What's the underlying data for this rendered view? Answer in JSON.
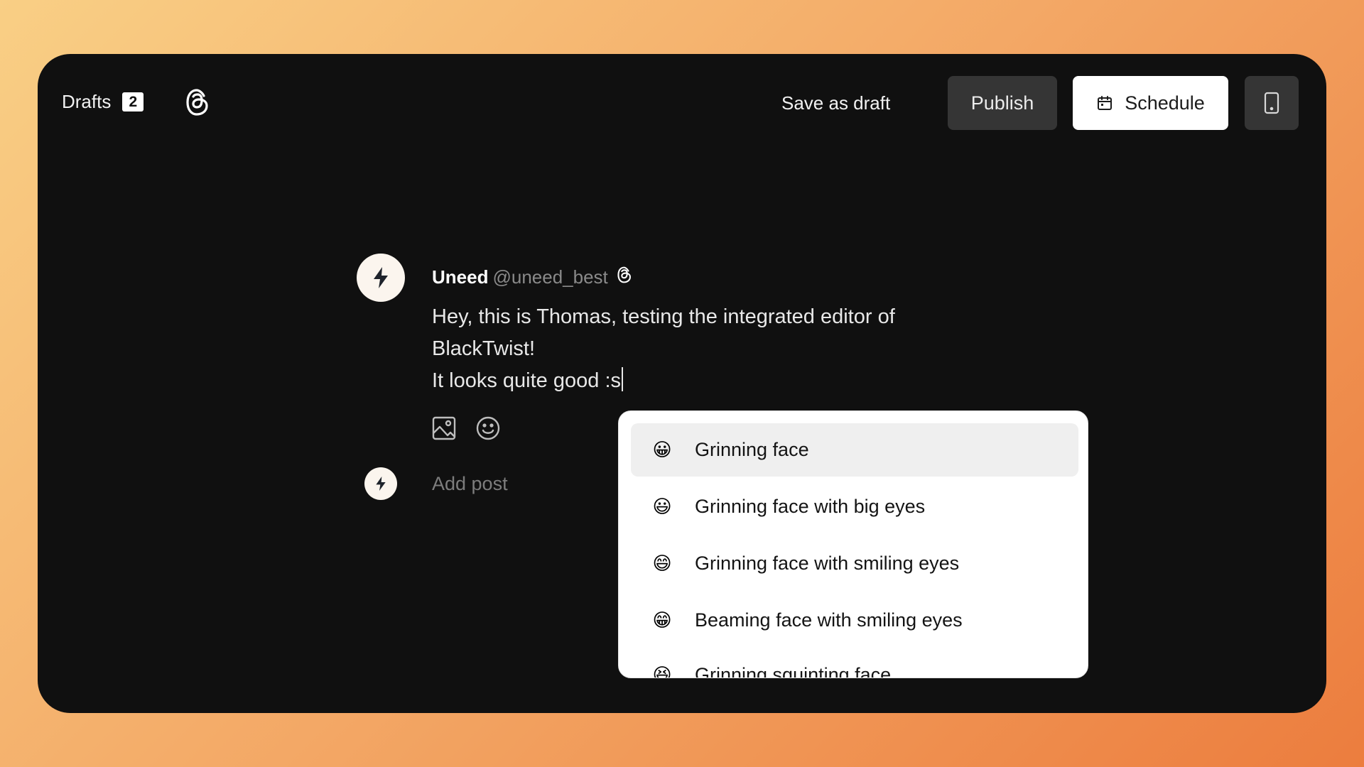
{
  "header": {
    "drafts_label": "Drafts",
    "drafts_count": "2",
    "save_draft_label": "Save as draft",
    "publish_label": "Publish",
    "schedule_label": "Schedule"
  },
  "post": {
    "author_name": "Uneed",
    "author_handle": "@uneed_best",
    "text_lines": [
      "Hey, this is Thomas, testing the integrated editor of",
      "BlackTwist!",
      "It looks quite good :s"
    ],
    "add_post_placeholder": "Add post"
  },
  "emoji_menu": {
    "items": [
      {
        "glyph": "😀",
        "label": "Grinning face",
        "selected": true
      },
      {
        "glyph": "😃",
        "label": "Grinning face with big eyes",
        "selected": false
      },
      {
        "glyph": "😄",
        "label": "Grinning face with smiling eyes",
        "selected": false
      },
      {
        "glyph": "😁",
        "label": "Beaming face with smiling eyes",
        "selected": false
      },
      {
        "glyph": "😆",
        "label": "Grinning squinting face",
        "selected": false
      }
    ]
  },
  "colors": {
    "window_bg": "#101010",
    "publish_bg": "#353535",
    "schedule_bg": "#ffffff",
    "menu_highlight": "#efefef"
  }
}
